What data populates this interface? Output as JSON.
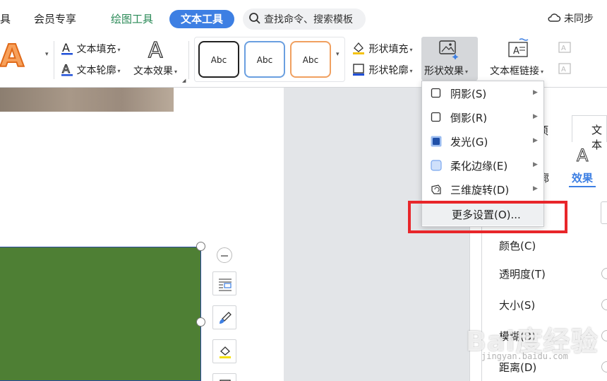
{
  "tabs": {
    "partial_left": "具",
    "member": "会员专享",
    "drawing_tools": "绘图工具",
    "text_tools": "文本工具"
  },
  "search": {
    "placeholder": "查找命令、搜索模板"
  },
  "sync": {
    "label": "未同步"
  },
  "ribbon": {
    "big_text_style_glyph": "A",
    "text_fill": "文本填充",
    "text_outline": "文本轮廓",
    "text_effect": "文本效果",
    "text_effect_glyph": "A",
    "style_samples": [
      "Abc",
      "Abc",
      "Abc"
    ],
    "shape_fill": "形状填充",
    "shape_outline": "形状轮廓",
    "shape_effect": "形状效果",
    "textbox_link": "文本框链接"
  },
  "shape_effect_menu": {
    "items": [
      {
        "label": "阴影(S)",
        "icon": "shadow-icon"
      },
      {
        "label": "倒影(R)",
        "icon": "reflection-icon"
      },
      {
        "label": "发光(G)",
        "icon": "glow-icon"
      },
      {
        "label": "柔化边缘(E)",
        "icon": "soft-edges-icon"
      },
      {
        "label": "三维旋转(D)",
        "icon": "3d-rotation-icon"
      }
    ],
    "more_settings": "更多设置(O)..."
  },
  "task_pane": {
    "tab_partial_options": "项",
    "tab_partial_text": "文本",
    "sub_tab_partial": "廓",
    "sub_tab_effect": "效果",
    "effect_glyph": "A",
    "labels": {
      "color": "颜色(C)",
      "transparency": "透明度(T)",
      "size": "大小(S)",
      "blur": "模糊(B)",
      "distance": "距离(D)"
    }
  },
  "watermark": {
    "main": "Bai度经验",
    "sub": "jingyan.baidu.com"
  },
  "colors": {
    "accent_blue": "#3d7fe3",
    "green_tab": "#2a8a57",
    "shape_fill_green": "#4e7f34",
    "highlight_red": "#e8262a"
  }
}
